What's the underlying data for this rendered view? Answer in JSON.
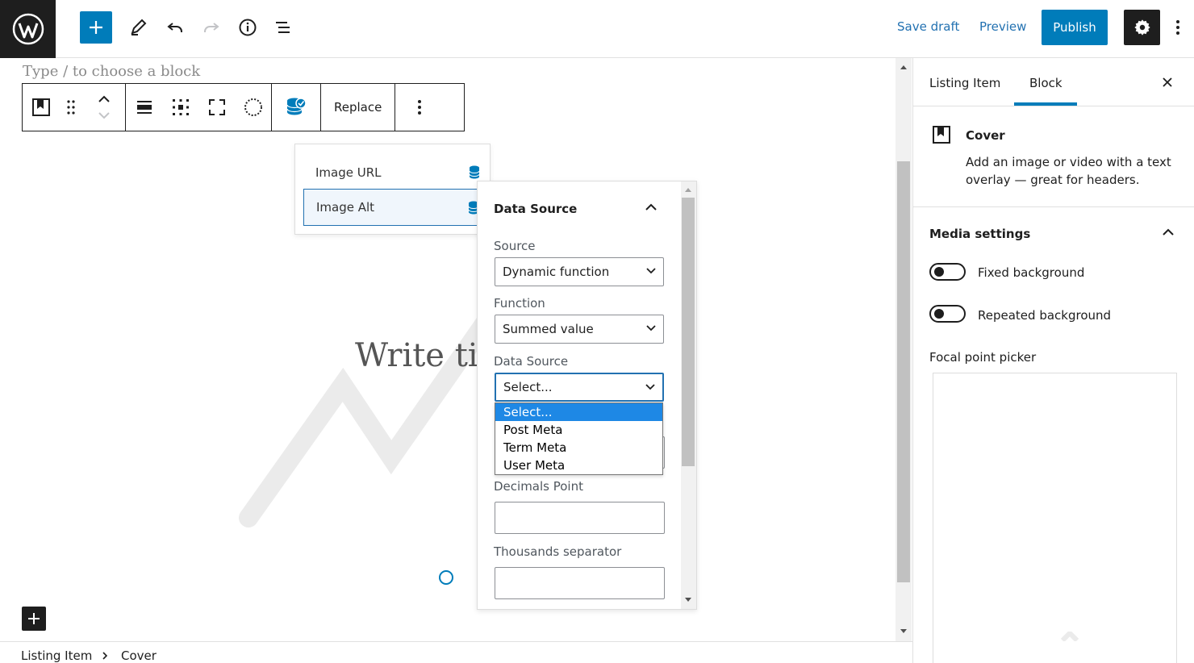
{
  "header": {
    "save_draft": "Save draft",
    "preview": "Preview",
    "publish": "Publish"
  },
  "canvas": {
    "placeholder": "Type / to choose a block",
    "cover_title": "Write titl"
  },
  "block_toolbar": {
    "replace_label": "Replace"
  },
  "field_list": {
    "items": [
      {
        "label": "Image URL"
      },
      {
        "label": "Image Alt"
      }
    ]
  },
  "data_source_panel": {
    "title": "Data Source",
    "source_label": "Source",
    "source_value": "Dynamic function",
    "function_label": "Function",
    "function_value": "Summed value",
    "data_source_label": "Data Source",
    "data_source_value": "Select...",
    "decimals_label": "Decimals Point",
    "thousands_label": "Thousands separator",
    "dropdown_options": [
      "Select...",
      "Post Meta",
      "Term Meta",
      "User Meta"
    ]
  },
  "sidebar": {
    "tabs": [
      {
        "label": "Listing Item"
      },
      {
        "label": "Block"
      }
    ],
    "block_name": "Cover",
    "block_description": "Add an image or video with a text overlay — great for headers.",
    "media_settings_title": "Media settings",
    "fixed_background": "Fixed background",
    "repeated_background": "Repeated background",
    "focal_point_label": "Focal point picker"
  },
  "breadcrumb": {
    "items": [
      "Listing Item",
      "Cover"
    ]
  },
  "colors": {
    "accent": "#007cba",
    "dark": "#1e1e1e",
    "link": "#2271b1",
    "dropdown_highlight": "#1e88e5"
  }
}
